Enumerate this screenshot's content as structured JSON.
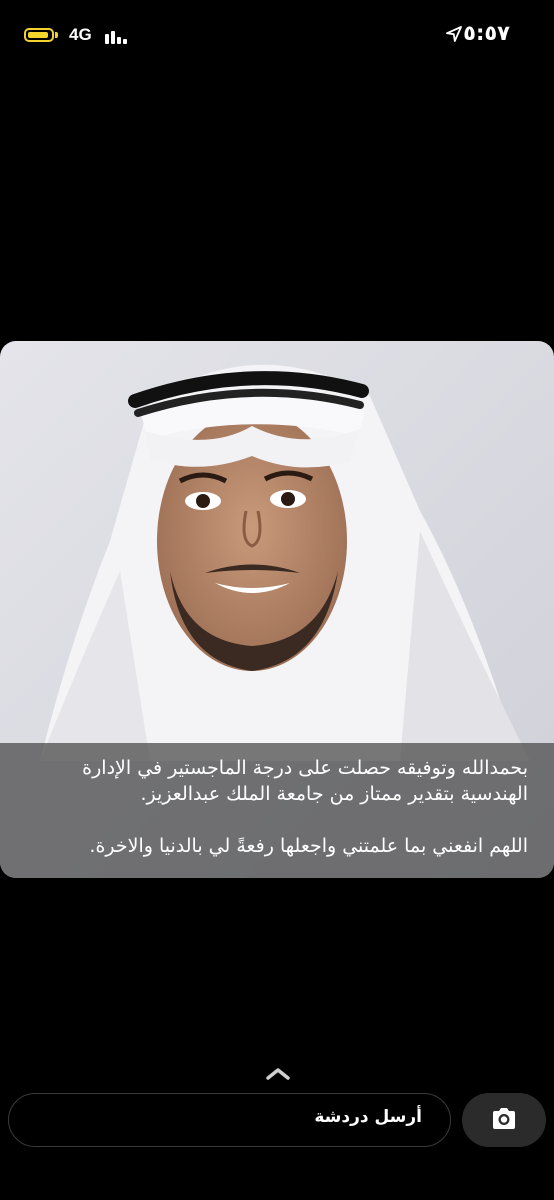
{
  "status_bar": {
    "network": "4G",
    "time": "٥:٥٧",
    "battery_level": 0.9,
    "battery_color": "#f5d42c"
  },
  "story": {
    "caption_line1": "بحمدالله وتوفيقه حصلت على درجة الماجستير في الإدارة",
    "caption_line2": "الهندسية بتقدير ممتاز من جامعة الملك عبدالعزيز.",
    "caption_line3": "اللهم انفعني بما علمتني واجعلها رفعةً لي بالدنيا والاخرة."
  },
  "chat": {
    "placeholder": "أرسل دردشة"
  },
  "icons": {
    "location": "location-arrow-icon",
    "camera": "camera-icon",
    "swipe_up": "chevron-up-icon"
  }
}
